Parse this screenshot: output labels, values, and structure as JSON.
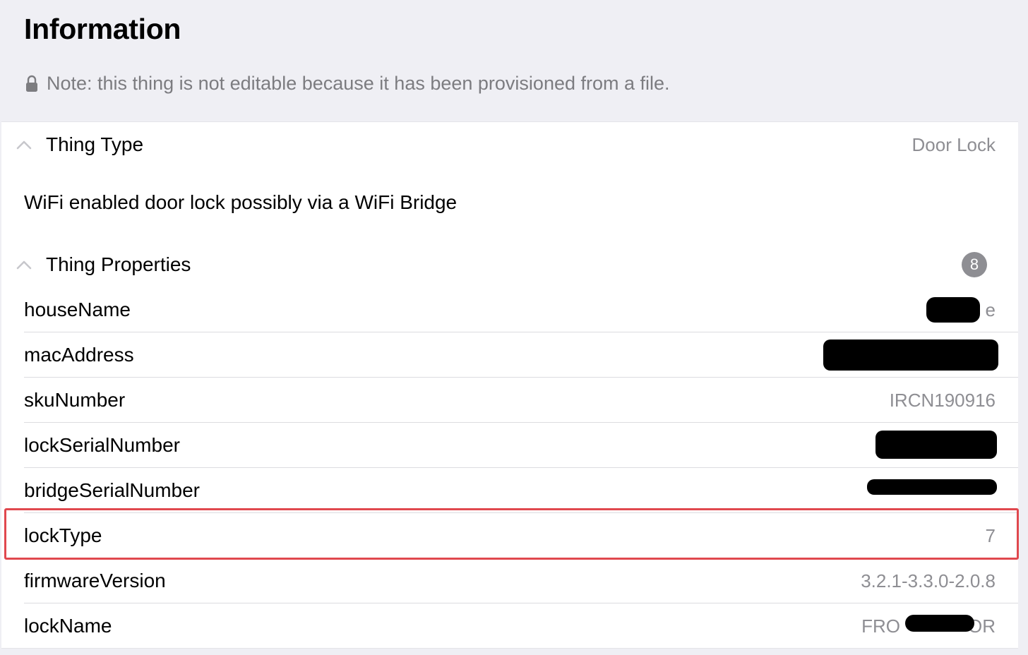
{
  "page": {
    "title": "Information",
    "note": "Note: this thing is not editable because it has been provisioned from a file.",
    "note_icon": "lock-icon"
  },
  "thing_type": {
    "header_label": "Thing Type",
    "value": "Door Lock",
    "description": "WiFi enabled door lock possibly via a WiFi Bridge",
    "icon": "chevron-up-icon"
  },
  "thing_properties": {
    "header_label": "Thing Properties",
    "count": "8",
    "icon": "chevron-up-icon",
    "items": [
      {
        "key": "houseName",
        "value": "e",
        "redacted": true
      },
      {
        "key": "macAddress",
        "value": "",
        "redacted": true
      },
      {
        "key": "skuNumber",
        "value": "IRCN190916",
        "redacted": false
      },
      {
        "key": "lockSerialNumber",
        "value": "",
        "redacted": true
      },
      {
        "key": "bridgeSerialNumber",
        "value": "",
        "redacted": true
      },
      {
        "key": "lockType",
        "value": "7",
        "redacted": false,
        "highlighted": true
      },
      {
        "key": "firmwareVersion",
        "value": "3.2.1-3.3.0-2.0.8",
        "redacted": false
      },
      {
        "key": "lockName",
        "value": "FRO",
        "value_suffix": "OR",
        "redacted": true
      }
    ]
  },
  "colors": {
    "background": "#efeff4",
    "card": "#ffffff",
    "secondary_text": "#8e8e93",
    "highlight": "#e0484e",
    "redaction": "#000000"
  }
}
